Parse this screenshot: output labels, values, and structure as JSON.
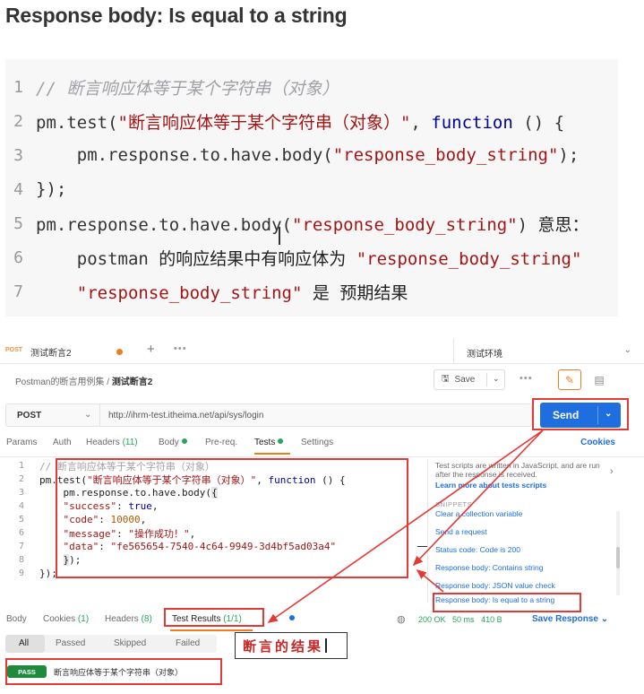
{
  "title": "Response body: Is equal to a string",
  "code": [
    {
      "n": "1",
      "parts": [
        {
          "c": "cmt",
          "t": "// 断言响应体等于某个字符串（对象）"
        }
      ]
    },
    {
      "n": "2",
      "parts": [
        {
          "c": "",
          "t": "pm.test("
        },
        {
          "c": "str",
          "t": "\"断言响应体等于某个字符串（对象）\""
        },
        {
          "c": "",
          "t": ", "
        },
        {
          "c": "kw",
          "t": "function"
        },
        {
          "c": "",
          "t": " () {"
        }
      ]
    },
    {
      "n": "3",
      "parts": [
        {
          "c": "",
          "t": "    pm.response.to.have.body("
        },
        {
          "c": "str",
          "t": "\"response_body_string\""
        },
        {
          "c": "",
          "t": ");"
        }
      ]
    },
    {
      "n": "4",
      "parts": [
        {
          "c": "",
          "t": "});"
        }
      ]
    },
    {
      "n": "5",
      "parts": [
        {
          "c": "",
          "t": "pm.response.to.have.body("
        },
        {
          "c": "str",
          "t": "\"response_body_string\""
        },
        {
          "c": "",
          "t": ") "
        },
        {
          "c": "zh",
          "t": "意思："
        }
      ]
    },
    {
      "n": "6",
      "parts": [
        {
          "c": "",
          "t": "    postman "
        },
        {
          "c": "zh",
          "t": "的响应结果中有响应体为 "
        },
        {
          "c": "str",
          "t": "\"response_body_string\""
        }
      ]
    },
    {
      "n": "7",
      "parts": [
        {
          "c": "",
          "t": "    "
        },
        {
          "c": "str",
          "t": "\"response_body_string\""
        },
        {
          "c": "zh",
          "t": " 是 预期结果"
        }
      ]
    }
  ],
  "postman": {
    "tab": {
      "method": "POST",
      "name": "测试断言2",
      "plus": "+",
      "more": "•••"
    },
    "environment": "测试环境",
    "breadcrumb": {
      "collection": "Postman的断言用例集",
      "sep": "/",
      "request": "测试断言2"
    },
    "save_label": "Save",
    "more": "•••",
    "method": "POST",
    "url": "http://ihrm-test.itheima.net/api/sys/login",
    "send_label": "Send",
    "request_tabs": [
      {
        "label": "Params"
      },
      {
        "label": "Auth"
      },
      {
        "label": "Headers",
        "count": "(11)"
      },
      {
        "label": "Body"
      },
      {
        "label": "Pre-req."
      },
      {
        "label": "Tests"
      },
      {
        "label": "Settings"
      }
    ],
    "cookies_label": "Cookies",
    "editor": [
      {
        "n": "1",
        "parts": [
          {
            "c": "cmt",
            "t": "// 断言响应体等于某个字符串（对象）"
          }
        ]
      },
      {
        "n": "2",
        "parts": [
          {
            "c": "",
            "t": "pm.test("
          },
          {
            "c": "str",
            "t": "\"断言响应体等于某个字符串（对象）\""
          },
          {
            "c": "",
            "t": ", "
          },
          {
            "c": "kw",
            "t": "function"
          },
          {
            "c": "",
            "t": " () {"
          }
        ]
      },
      {
        "n": "3",
        "parts": [
          {
            "c": "",
            "t": "    pm.response.to.have.body("
          },
          {
            "c": "hl",
            "t": "{"
          }
        ]
      },
      {
        "n": "4",
        "parts": [
          {
            "c": "",
            "t": "    "
          },
          {
            "c": "key",
            "t": "\"success\""
          },
          {
            "c": "",
            "t": ": "
          },
          {
            "c": "bool",
            "t": "true"
          },
          {
            "c": "",
            "t": ","
          }
        ]
      },
      {
        "n": "5",
        "parts": [
          {
            "c": "",
            "t": "    "
          },
          {
            "c": "key",
            "t": "\"code\""
          },
          {
            "c": "",
            "t": ": "
          },
          {
            "c": "num",
            "t": "10000"
          },
          {
            "c": "",
            "t": ","
          }
        ]
      },
      {
        "n": "6",
        "parts": [
          {
            "c": "",
            "t": "    "
          },
          {
            "c": "key",
            "t": "\"message\""
          },
          {
            "c": "",
            "t": ": "
          },
          {
            "c": "str",
            "t": "\"操作成功！\""
          },
          {
            "c": "",
            "t": ","
          }
        ]
      },
      {
        "n": "7",
        "parts": [
          {
            "c": "",
            "t": "    "
          },
          {
            "c": "key",
            "t": "\"data\""
          },
          {
            "c": "",
            "t": ": "
          },
          {
            "c": "str",
            "t": "\"fe565654-7540-4c64-9949-3d4bf5ad03a4\""
          }
        ]
      },
      {
        "n": "8",
        "parts": [
          {
            "c": "",
            "t": "    "
          },
          {
            "c": "hl",
            "t": "}"
          },
          {
            "c": "",
            "t": ");"
          }
        ]
      },
      {
        "n": "9",
        "parts": [
          {
            "c": "",
            "t": "});"
          }
        ]
      }
    ],
    "sidebar": {
      "description": "Test scripts are written in JavaScript, and are run after the response is received.",
      "learn_more": "Learn more about tests scripts",
      "snippets_label": "SNIPPETS",
      "items": [
        "Clear a collection variable",
        "Send a request",
        "Status code: Code is 200",
        "Response body: Contains string",
        "Response body: JSON value check",
        "Response body: Is equal to a string"
      ]
    },
    "response_tabs": [
      {
        "label": "Body"
      },
      {
        "label": "Cookies",
        "count": "(1)"
      },
      {
        "label": "Headers",
        "count": "(8)"
      },
      {
        "label": "Test Results",
        "count": "(1/1)"
      }
    ],
    "status": {
      "code": "200 OK",
      "time": "50 ms",
      "size": "410 B"
    },
    "save_response_label": "Save Response",
    "filters": [
      "All",
      "Passed",
      "Skipped",
      "Failed"
    ],
    "result": {
      "badge": "PASS",
      "name": "断言响应体等于某个字符串（对象）"
    }
  },
  "annotation": {
    "conclusion": "断言的结果"
  },
  "colors": {
    "send": "#1f6ee0",
    "accent": "#ef7d20",
    "pass": "#1e8a3c",
    "highlight": "#e53935"
  }
}
